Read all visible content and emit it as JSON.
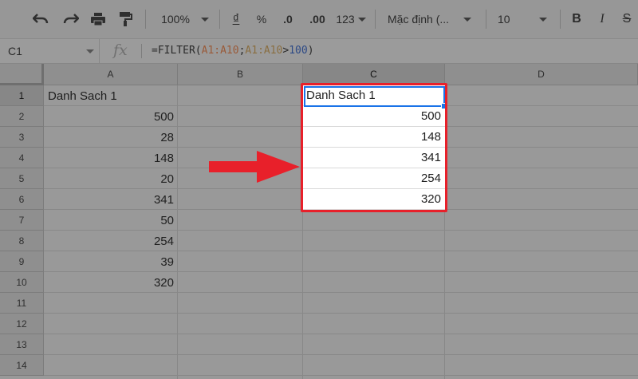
{
  "toolbar": {
    "undo_icon": "undo-icon",
    "redo_icon": "redo-icon",
    "print_icon": "print-icon",
    "paint_format_icon": "paint-format-icon",
    "zoom": "100%",
    "currency": "₫",
    "percent": "%",
    "decrease_decimal": ".0",
    "increase_decimal": ".00",
    "more_formats": "123",
    "font": "Mặc định (...",
    "font_size": "10",
    "bold": "B",
    "italic": "I",
    "strikethrough": "S"
  },
  "formula_bar": {
    "cell_ref": "C1",
    "fx": "fx",
    "formula_prefix": "=FILTER(",
    "formula_range1": "A1:A10",
    "formula_sep": ";",
    "formula_range2": "A1:A10",
    "formula_op": ">",
    "formula_num": "100",
    "formula_close": ")"
  },
  "columns": [
    "A",
    "B",
    "C",
    "D"
  ],
  "rows": [
    "1",
    "2",
    "3",
    "4",
    "5",
    "6",
    "7",
    "8",
    "9",
    "10",
    "11",
    "12",
    "13",
    "14"
  ],
  "column_a": [
    "Danh Sach 1",
    "500",
    "28",
    "148",
    "20",
    "341",
    "50",
    "254",
    "39",
    "320"
  ],
  "column_c": [
    "Danh Sach 1",
    "500",
    "148",
    "341",
    "254",
    "320"
  ],
  "colors": {
    "highlight_border": "#e8202a",
    "arrow": "#e8202a",
    "selection": "#1a73e8"
  }
}
